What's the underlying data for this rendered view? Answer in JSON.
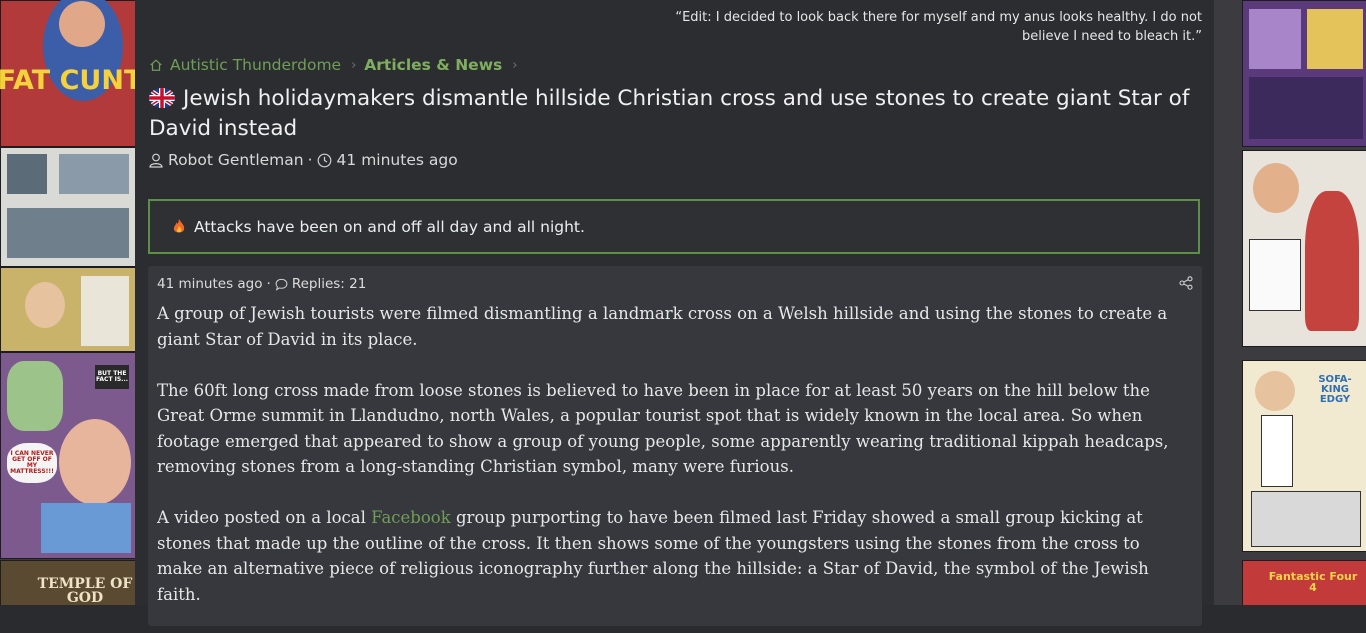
{
  "background": {
    "left_comic_texts": [
      "FAT CUNT",
      "BUT THE FACT IS...",
      "I CAN NEVER GET OFF OF MY MATTRESS!!!",
      "TEMPLE OF GOD"
    ],
    "right_comic_texts": [
      "SOFA-KING EDGY",
      "Fantastic Four 4"
    ]
  },
  "quote": {
    "text": "“Edit: I decided to look back there for myself and my anus looks healthy. I do not believe I need to bleach it.”"
  },
  "breadcrumb": {
    "home_label": "Autistic Thunderdome",
    "section_label": "Articles & News"
  },
  "thread": {
    "flag_icon": "uk-flag-icon",
    "title": "Jewish holidaymakers dismantle hillside Christian cross and use stones to create giant Star of David instead",
    "author": "Robot Gentleman",
    "separator": "·",
    "time_ago": "41 minutes ago"
  },
  "notice": {
    "icon": "fire-icon",
    "text": "Attacks have been on and off all day and all night."
  },
  "post": {
    "time_ago": "41 minutes ago",
    "separator": "·",
    "replies_label": "Replies: 21",
    "paragraph1": "A group of Jewish tourists were filmed dismantling a landmark cross on a Welsh hillside and using the stones to create a giant Star of David in its place.",
    "paragraph2": "The 60ft long cross made from loose stones is believed to have been in place for at least 50 years on the hill below the Great Orme summit in Llandudno, north Wales, a popular tourist spot that is widely known in the local area. So when footage emerged that appeared to show a group of young people, some apparently wearing traditional kippah headcaps, removing stones from a long-standing Christian symbol, many were furious.",
    "paragraph3_before": "A video posted on a local ",
    "paragraph3_link": "Facebook",
    "paragraph3_after": " group purporting to have been filmed last Friday showed a small group kicking at stones that made up the outline of the cross. It then shows some of the youngsters using the stones from the cross to make an alternative piece of religious iconography further along the hillside: a Star of David, the symbol of the Jewish faith."
  },
  "colors": {
    "accent_green": "#6f9e56",
    "notice_border": "#5e8f48",
    "post_bg": "#37383e"
  }
}
